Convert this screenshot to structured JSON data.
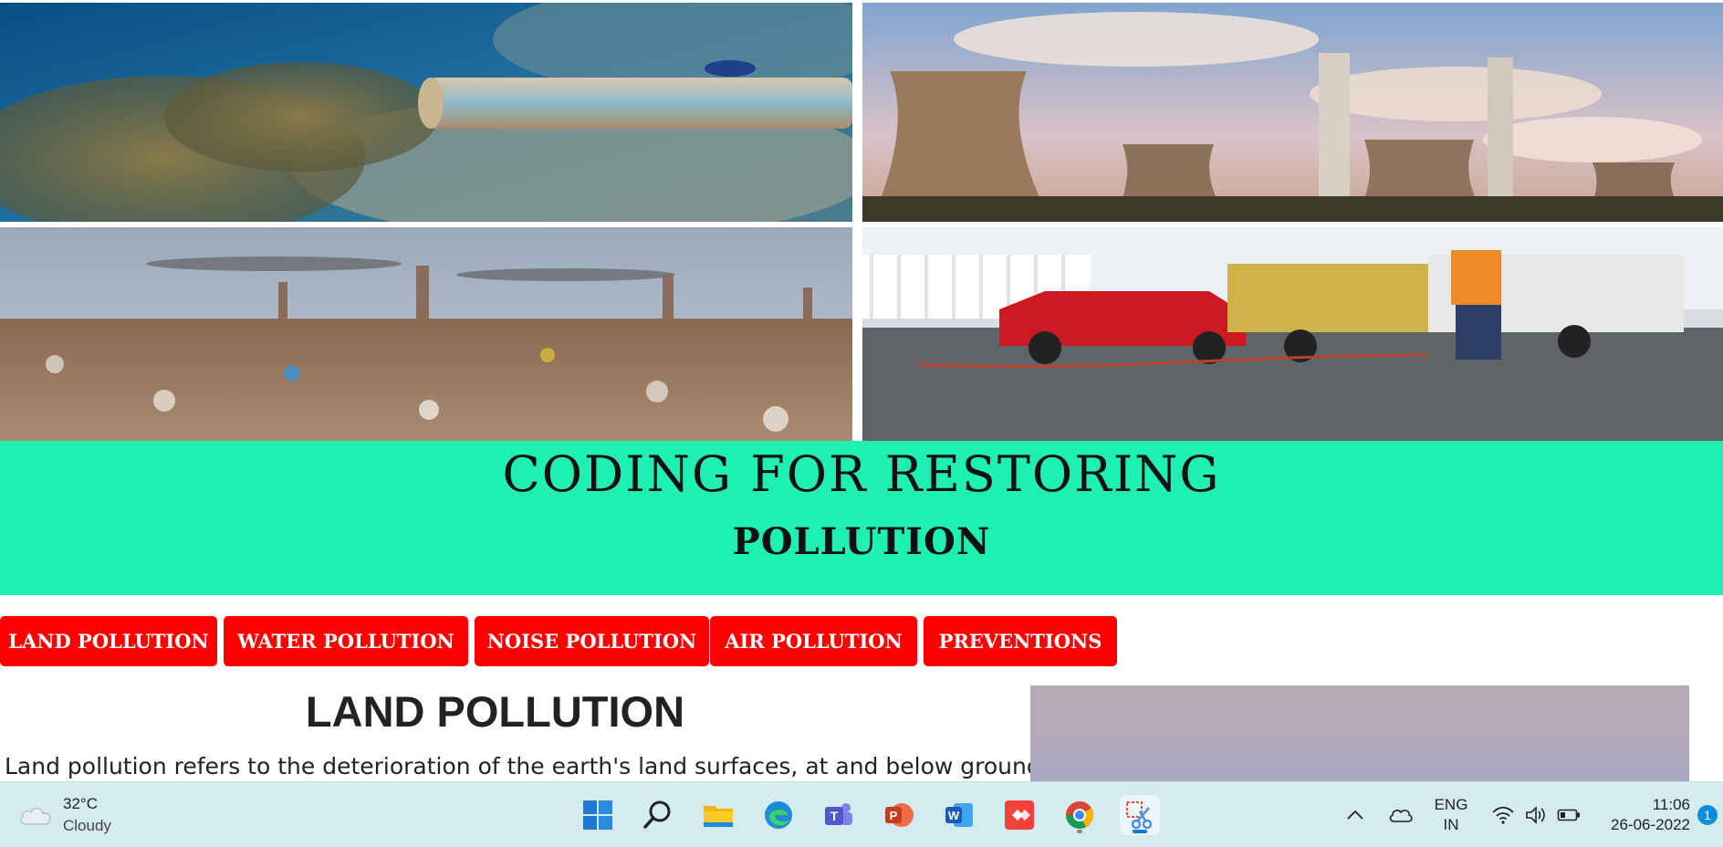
{
  "banner": {
    "line1": "CODING FOR RESTORING",
    "line2": "POLLUTION",
    "bg_color": "#1ff0b2"
  },
  "nav": {
    "button_color": "#ff0000",
    "items": [
      {
        "label": "LAND POLLUTION"
      },
      {
        "label": "WATER POLLUTION"
      },
      {
        "label": "NOISE POLLUTION"
      },
      {
        "label": "AIR POLLUTION"
      },
      {
        "label": "PREVENTIONS"
      }
    ]
  },
  "content": {
    "title": "LAND POLLUTION",
    "text": "Land pollution refers to the deterioration of the earth's land surfaces, at and below ground"
  },
  "photos": [
    {
      "icon": "water-pollution-photo"
    },
    {
      "icon": "air-pollution-photo"
    },
    {
      "icon": "land-pollution-photo"
    },
    {
      "icon": "noise-pollution-photo"
    }
  ],
  "taskbar": {
    "weather": {
      "temp": "32°C",
      "condition": "Cloudy",
      "icon": "cloud-icon"
    },
    "apps": [
      {
        "name": "start-button",
        "icon": "windows-icon"
      },
      {
        "name": "search-button",
        "icon": "search-icon"
      },
      {
        "name": "file-explorer-app",
        "icon": "folder-icon"
      },
      {
        "name": "edge-app",
        "icon": "edge-icon"
      },
      {
        "name": "teams-app",
        "icon": "teams-icon"
      },
      {
        "name": "powerpoint-app",
        "icon": "powerpoint-icon"
      },
      {
        "name": "word-app",
        "icon": "word-icon"
      },
      {
        "name": "anydesk-app",
        "icon": "anydesk-icon"
      },
      {
        "name": "chrome-app",
        "icon": "chrome-icon"
      },
      {
        "name": "snipping-tool-app",
        "icon": "snipping-tool-icon"
      }
    ],
    "language": {
      "line1": "ENG",
      "line2": "IN"
    },
    "clock": {
      "time": "11:06",
      "date": "26-06-2022"
    },
    "notification_count": "1"
  }
}
